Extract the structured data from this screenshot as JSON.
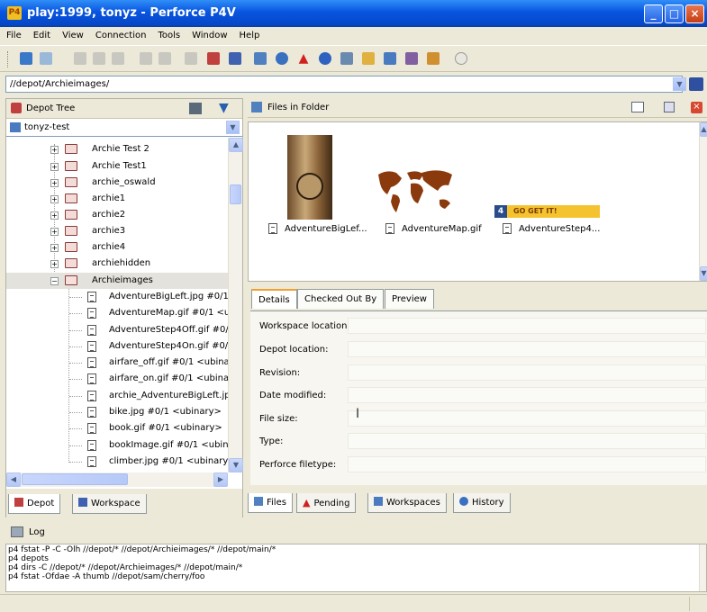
{
  "window": {
    "title": "play:1999, tonyz - Perforce P4V",
    "logo": "P4",
    "min": "_",
    "max": "□",
    "close": "×"
  },
  "menu": [
    "File",
    "Edit",
    "View",
    "Connection",
    "Tools",
    "Window",
    "Help"
  ],
  "address": {
    "value": "//depot/Archieimages/"
  },
  "depot_tree": {
    "title": "Depot Tree",
    "workspace_selector": "tonyz-test",
    "folders": [
      "Archie Test 2",
      "Archie Test1",
      "archie_oswald",
      "archie1",
      "archie2",
      "archie3",
      "archie4",
      "archiehidden",
      "Archieimages"
    ],
    "files": [
      "AdventureBigLeft.jpg #0/1 <",
      "AdventureMap.gif #0/1 <ub",
      "AdventureStep4Off.gif #0/1",
      "AdventureStep4On.gif #0/1",
      "airfare_off.gif #0/1 <ubinar",
      "airfare_on.gif #0/1 <ubinary",
      "archie_AdventureBigLeft.jpg",
      "bike.jpg #0/1 <ubinary>",
      "book.gif #0/1 <ubinary>",
      "bookImage.gif #0/1 <ubinar",
      "climber.jpg #0/1 <ubinary>"
    ]
  },
  "left_tabs": [
    "Depot",
    "Workspace"
  ],
  "files_in_folder": {
    "title": "Files in Folder",
    "thumbnails": [
      {
        "name": "AdventureBigLef..."
      },
      {
        "name": "AdventureMap.gif"
      },
      {
        "name": "AdventureStep4...",
        "badge_num": "4",
        "badge_text": "GO GET IT!"
      }
    ]
  },
  "details": {
    "tabs": [
      "Details",
      "Checked Out By",
      "Preview"
    ],
    "fields": [
      "Workspace location:",
      "Depot location:",
      "Revision:",
      "Date modified:",
      "File size:",
      "Type:",
      "Perforce filetype:"
    ]
  },
  "right_tabs": [
    "Files",
    "Pending",
    "Workspaces",
    "History"
  ],
  "log": {
    "title": "Log",
    "lines": [
      "p4 fstat -P -C -Olh //depot/* //depot/Archieimages/* //depot/main/*",
      "p4 depots",
      "p4 dirs -C //depot/* //depot/Archieimages/* //depot/main/*",
      "p4 fstat -Ofdae -A thumb //depot/sam/cherry/foo"
    ]
  },
  "colors": {
    "titlebar": "#0854e0",
    "chrome": "#ece9d8",
    "selected_row": "#e4e2dc",
    "badge": "#f5c330"
  }
}
